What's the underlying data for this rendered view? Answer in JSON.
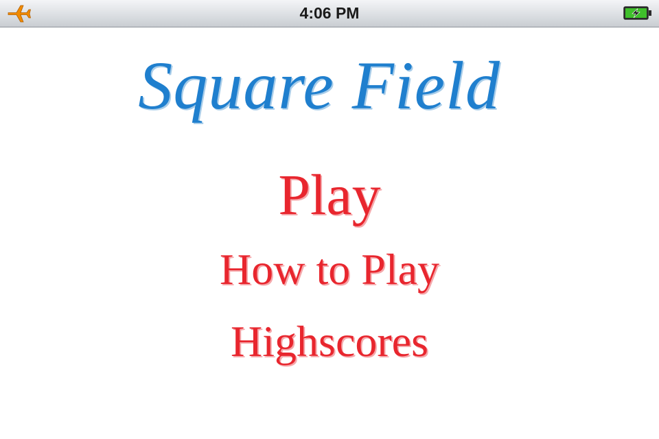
{
  "status_bar": {
    "time": "4:06 PM",
    "left_icon": "airplane-mode-icon",
    "right_icon": "battery-charging-icon",
    "battery_level": 0.9,
    "airplane_color": "#f08a00",
    "battery_color": "#3fbf2b"
  },
  "title": {
    "text": "Square Field",
    "color": "#1f7fce"
  },
  "menu": {
    "color": "#e8262e",
    "items": [
      {
        "label": "Play"
      },
      {
        "label": "How to Play"
      },
      {
        "label": "Highscores"
      }
    ]
  }
}
